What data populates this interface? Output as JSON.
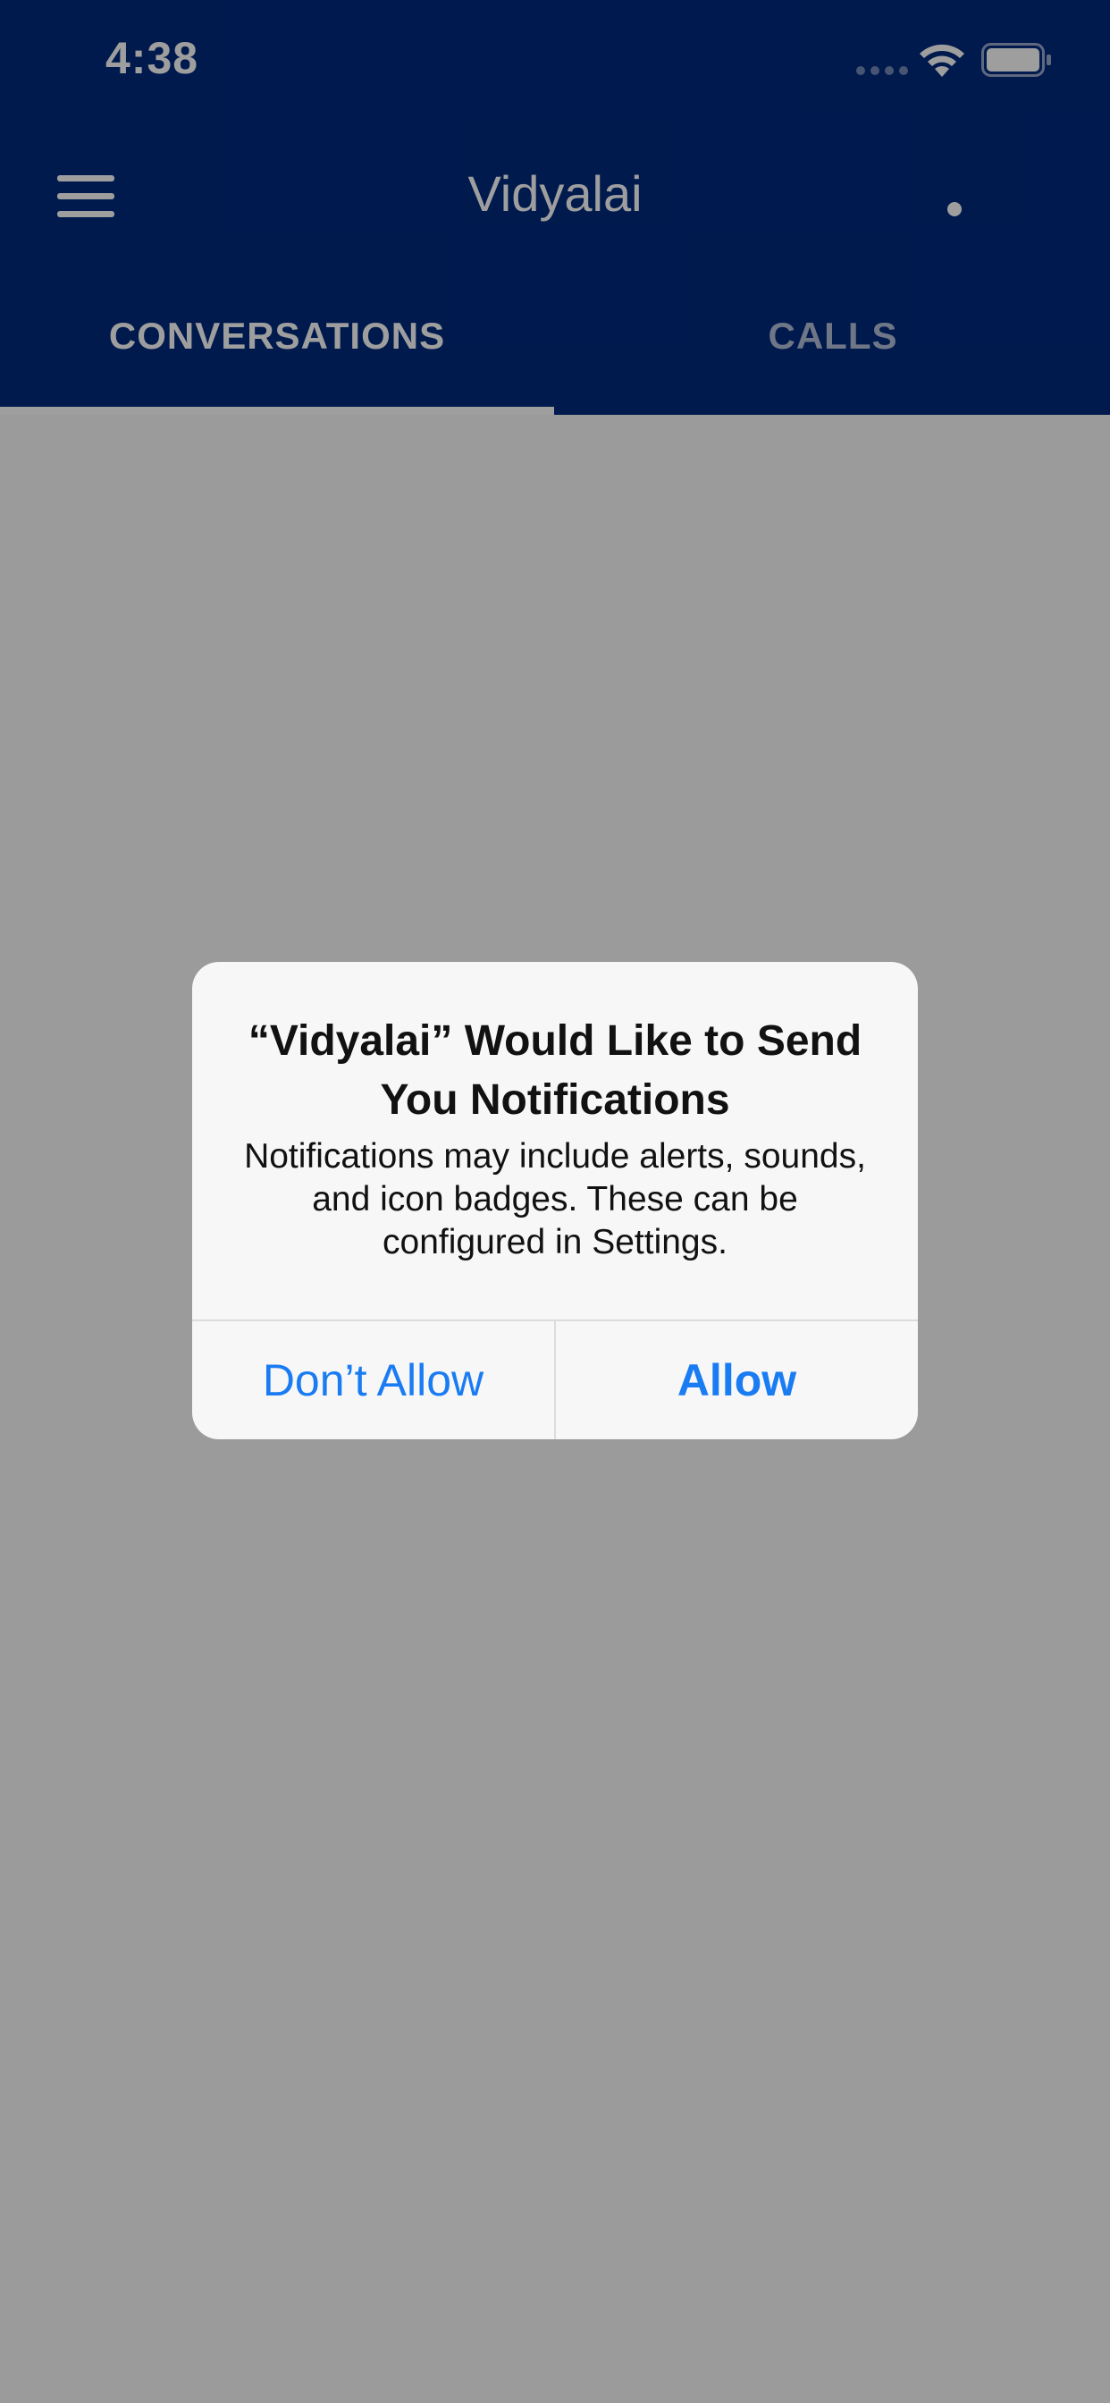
{
  "status_bar": {
    "time": "4:38"
  },
  "app_bar": {
    "title": "Vidyalai",
    "menu_icon": "hamburger-menu-icon",
    "more_icon": "dot-icon"
  },
  "tabs": [
    {
      "label": "CONVERSATIONS",
      "selected": true
    },
    {
      "label": "CALLS",
      "selected": false
    }
  ],
  "alert": {
    "title": "“Vidyalai” Would Like to Send You Notifications",
    "message": "Notifications may include alerts, sounds, and icon badges. These can be configured in Settings.",
    "buttons": {
      "dont_allow": "Don’t Allow",
      "allow": "Allow"
    }
  },
  "colors": {
    "header": "#002a7f",
    "accent": "#1a7cf2"
  }
}
